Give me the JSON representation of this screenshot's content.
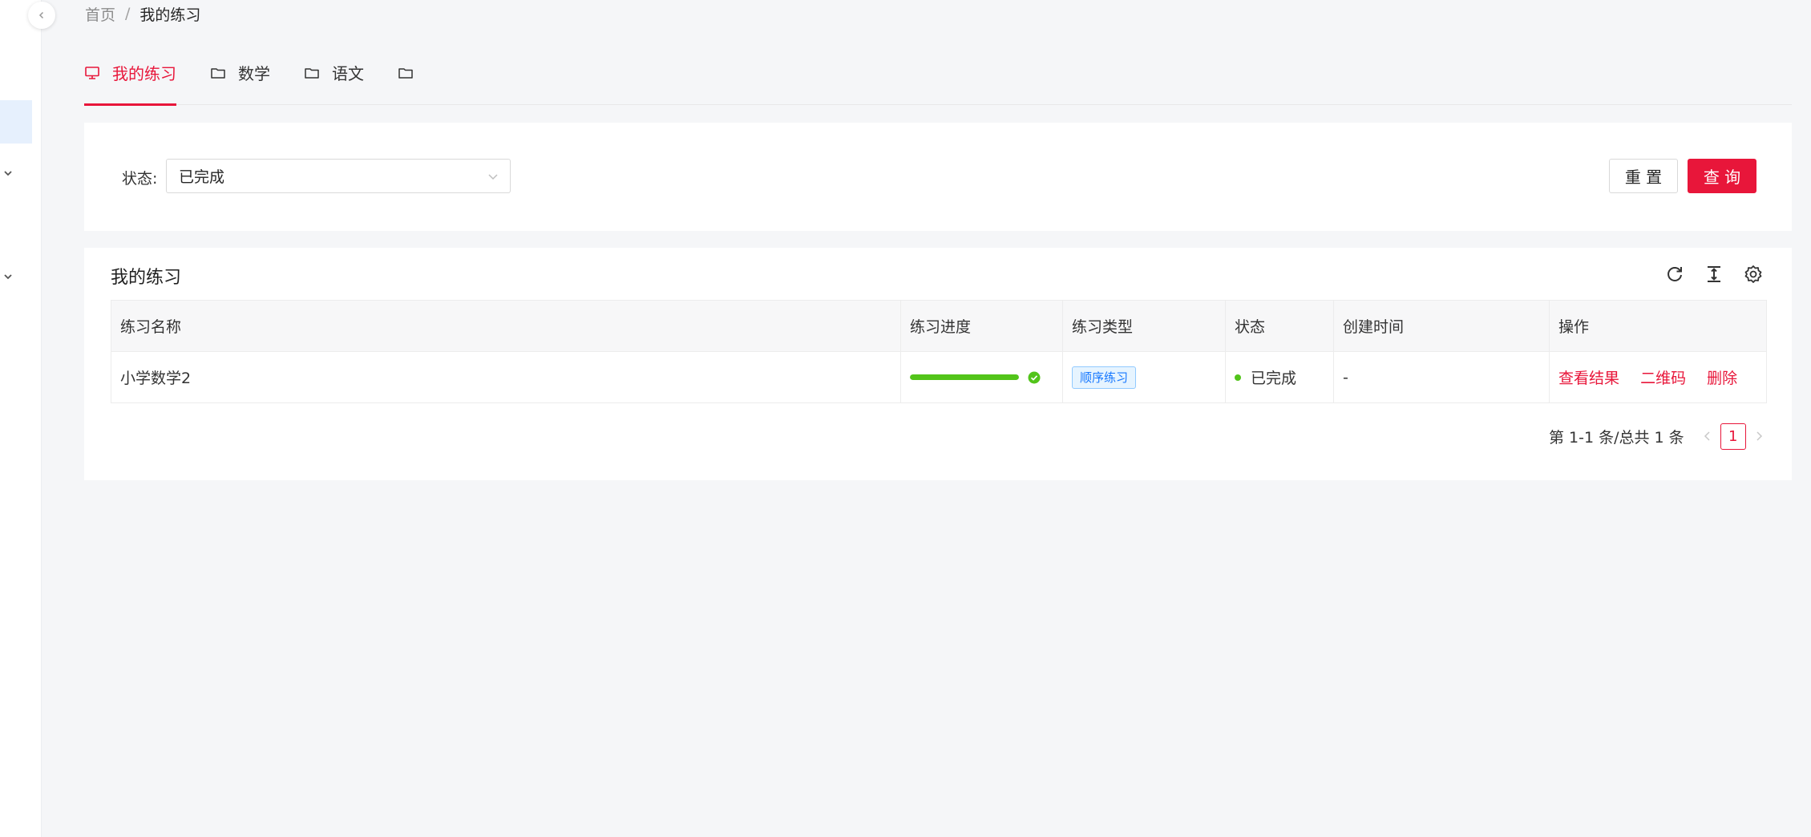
{
  "breadcrumb": {
    "home": "首页",
    "separator": "/",
    "current": "我的练习"
  },
  "tabs": [
    {
      "label": "我的练习",
      "icon": "monitor-icon",
      "active": true
    },
    {
      "label": "数学",
      "icon": "folder-icon",
      "active": false
    },
    {
      "label": "语文",
      "icon": "folder-icon",
      "active": false
    },
    {
      "label": "",
      "icon": "folder-icon",
      "active": false
    }
  ],
  "filter": {
    "status_label": "状态:",
    "status_value": "已完成",
    "reset_label": "重 置",
    "query_label": "查 询"
  },
  "table": {
    "title": "我的练习",
    "toolbar_icons": [
      "reload-icon",
      "column-height-icon",
      "settings-icon"
    ],
    "columns": [
      "练习名称",
      "练习进度",
      "练习类型",
      "状态",
      "创建时间",
      "操作"
    ],
    "rows": [
      {
        "name": "小学数学2",
        "progress": 1.0,
        "type": "顺序练习",
        "status": "已完成",
        "created": "-",
        "actions": [
          "查看结果",
          "二维码",
          "删除"
        ]
      }
    ]
  },
  "pagination": {
    "summary": "第 1-1 条/总共 1 条",
    "current_page": "1"
  },
  "colors": {
    "accent": "#e8163a",
    "success": "#52c41a",
    "tag_blue": "#1677ff"
  }
}
